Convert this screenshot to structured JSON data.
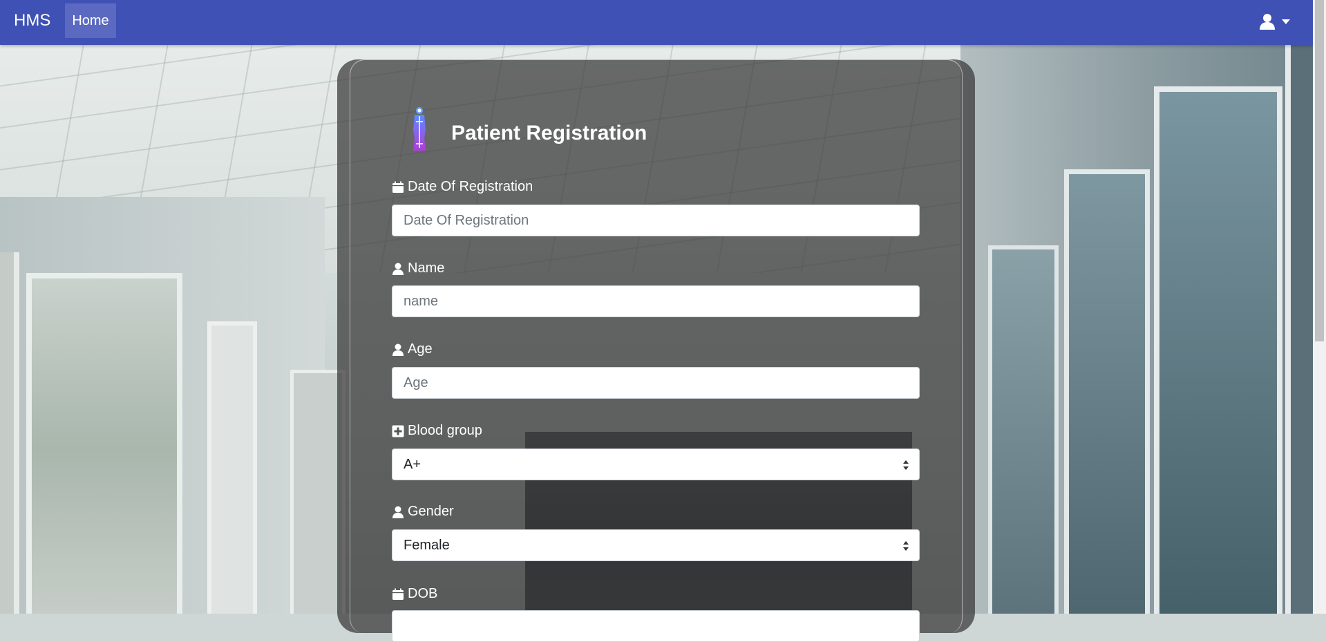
{
  "navbar": {
    "brand": "HMS",
    "home_label": "Home",
    "user_icon": "user-icon",
    "caret_icon": "caret-down-icon",
    "color": "#3f51b5"
  },
  "form": {
    "title": "Patient Registration",
    "title_icon": "patient-icon",
    "fields": {
      "registration_date": {
        "label": "Date Of Registration",
        "placeholder": "Date Of Registration",
        "icon": "calendar-icon"
      },
      "name": {
        "label": "Name",
        "placeholder": "name",
        "icon": "user-icon"
      },
      "age": {
        "label": "Age",
        "placeholder": "Age",
        "icon": "user-icon"
      },
      "blood_group": {
        "label": "Blood group",
        "value": "A+",
        "icon": "plus-square-icon"
      },
      "gender": {
        "label": "Gender",
        "value": "Female",
        "icon": "user-icon"
      },
      "dob": {
        "label": "DOB",
        "icon": "calendar-icon"
      }
    }
  }
}
